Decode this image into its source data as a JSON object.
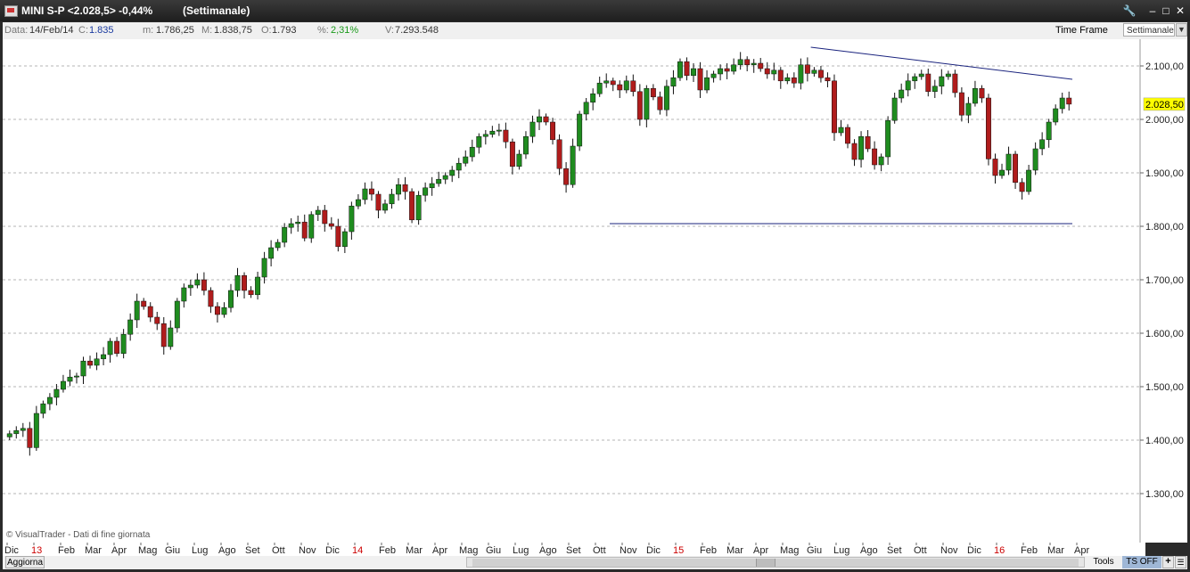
{
  "window": {
    "title": "MINI S-P <2.028,5> -0,44%",
    "period": "(Settimanale)"
  },
  "info": {
    "data_label": "Data:",
    "data_value": "14/Feb/14",
    "c_label": "C:",
    "c_value": "1.835",
    "m_label": "m:",
    "m_value": "1.786,25",
    "M_label": "M:",
    "M_value": "1.838,75",
    "o_label": "O:",
    "o_value": "1.793",
    "pct_label": "%:",
    "pct_value": "2,31%",
    "v_label": "V:",
    "v_value": "7.293.548",
    "time_frame_label": "Time Frame",
    "time_frame_value": "Settimanale"
  },
  "footer": {
    "copyright": "© VisualTrader - Dati di fine giornata",
    "aggiorna": "Aggiorna",
    "tools": "Tools",
    "ts_off": "TS OFF",
    "plus": "+"
  },
  "colors": {
    "up": "#1f8c1f",
    "down": "#b01c1c",
    "trendline": "#1a237e",
    "grid": "#b5b5b5",
    "price_tag": "#ffff00",
    "year_label": "#cc0000"
  },
  "chart_data": {
    "type": "candlestick",
    "title": "MINI S-P",
    "timeframe": "weekly",
    "y_ticks": [
      {
        "v": 2100,
        "label": "2.100,00"
      },
      {
        "v": 2000,
        "label": "2.000,00"
      },
      {
        "v": 1900,
        "label": "1.900,00"
      },
      {
        "v": 1800,
        "label": "1.800,00"
      },
      {
        "v": 1700,
        "label": "1.700,00"
      },
      {
        "v": 1600,
        "label": "1.600,00"
      },
      {
        "v": 1500,
        "label": "1.500,00"
      },
      {
        "v": 1400,
        "label": "1.400,00"
      },
      {
        "v": 1300,
        "label": "1.300,00"
      }
    ],
    "ylim": [
      1250,
      2150
    ],
    "x_labels": [
      {
        "label": "Dic",
        "year": false
      },
      {
        "label": "13",
        "year": true
      },
      {
        "label": "Feb",
        "year": false
      },
      {
        "label": "Mar",
        "year": false
      },
      {
        "label": "Apr",
        "year": false
      },
      {
        "label": "Mag",
        "year": false
      },
      {
        "label": "Giu",
        "year": false
      },
      {
        "label": "Lug",
        "year": false
      },
      {
        "label": "Ago",
        "year": false
      },
      {
        "label": "Set",
        "year": false
      },
      {
        "label": "Ott",
        "year": false
      },
      {
        "label": "Nov",
        "year": false
      },
      {
        "label": "Dic",
        "year": false
      },
      {
        "label": "14",
        "year": true
      },
      {
        "label": "Feb",
        "year": false
      },
      {
        "label": "Mar",
        "year": false
      },
      {
        "label": "Apr",
        "year": false
      },
      {
        "label": "Mag",
        "year": false
      },
      {
        "label": "Giu",
        "year": false
      },
      {
        "label": "Lug",
        "year": false
      },
      {
        "label": "Ago",
        "year": false
      },
      {
        "label": "Set",
        "year": false
      },
      {
        "label": "Ott",
        "year": false
      },
      {
        "label": "Nov",
        "year": false
      },
      {
        "label": "Dic",
        "year": false
      },
      {
        "label": "15",
        "year": true
      },
      {
        "label": "Feb",
        "year": false
      },
      {
        "label": "Mar",
        "year": false
      },
      {
        "label": "Apr",
        "year": false
      },
      {
        "label": "Mag",
        "year": false
      },
      {
        "label": "Giu",
        "year": false
      },
      {
        "label": "Lug",
        "year": false
      },
      {
        "label": "Ago",
        "year": false
      },
      {
        "label": "Set",
        "year": false
      },
      {
        "label": "Ott",
        "year": false
      },
      {
        "label": "Nov",
        "year": false
      },
      {
        "label": "Dic",
        "year": false
      },
      {
        "label": "16",
        "year": true
      },
      {
        "label": "Feb",
        "year": false
      },
      {
        "label": "Mar",
        "year": false
      },
      {
        "label": "Apr",
        "year": false
      }
    ],
    "last_price": {
      "v": 2028.5,
      "label": "2.028,50"
    },
    "support_line": {
      "value": 1805
    },
    "resistance_line": {
      "start": 2135,
      "end": 2075
    },
    "closes": [
      1412,
      1418,
      1422,
      1386,
      1450,
      1468,
      1480,
      1495,
      1510,
      1518,
      1520,
      1548,
      1540,
      1552,
      1560,
      1585,
      1562,
      1598,
      1625,
      1660,
      1650,
      1630,
      1618,
      1575,
      1610,
      1660,
      1685,
      1690,
      1700,
      1680,
      1650,
      1635,
      1648,
      1680,
      1708,
      1680,
      1672,
      1705,
      1740,
      1760,
      1770,
      1798,
      1805,
      1808,
      1778,
      1822,
      1830,
      1805,
      1800,
      1762,
      1790,
      1838,
      1850,
      1870,
      1860,
      1830,
      1842,
      1860,
      1878,
      1865,
      1812,
      1858,
      1872,
      1880,
      1888,
      1895,
      1905,
      1918,
      1930,
      1948,
      1968,
      1972,
      1978,
      1980,
      1958,
      1912,
      1935,
      1968,
      1995,
      2005,
      1995,
      1962,
      1908,
      1878,
      1950,
      2010,
      2032,
      2048,
      2068,
      2072,
      2065,
      2055,
      2072,
      2052,
      2000,
      2058,
      2042,
      2018,
      2062,
      2078,
      2108,
      2082,
      2095,
      2055,
      2078,
      2085,
      2095,
      2090,
      2102,
      2112,
      2102,
      2105,
      2095,
      2085,
      2092,
      2072,
      2078,
      2068,
      2102,
      2086,
      2092,
      2078,
      2072,
      1975,
      1985,
      1955,
      1925,
      1968,
      1945,
      1915,
      1930,
      1998,
      2040,
      2055,
      2072,
      2080,
      2085,
      2052,
      2062,
      2080,
      2085,
      2050,
      2008,
      2030,
      2058,
      2040,
      1926,
      1895,
      1905,
      1935,
      1882,
      1865,
      1905,
      1945,
      1962,
      1995,
      2020,
      2040,
      2028.5
    ],
    "x_range": [
      "Dic 2012",
      "Apr 2016"
    ]
  }
}
